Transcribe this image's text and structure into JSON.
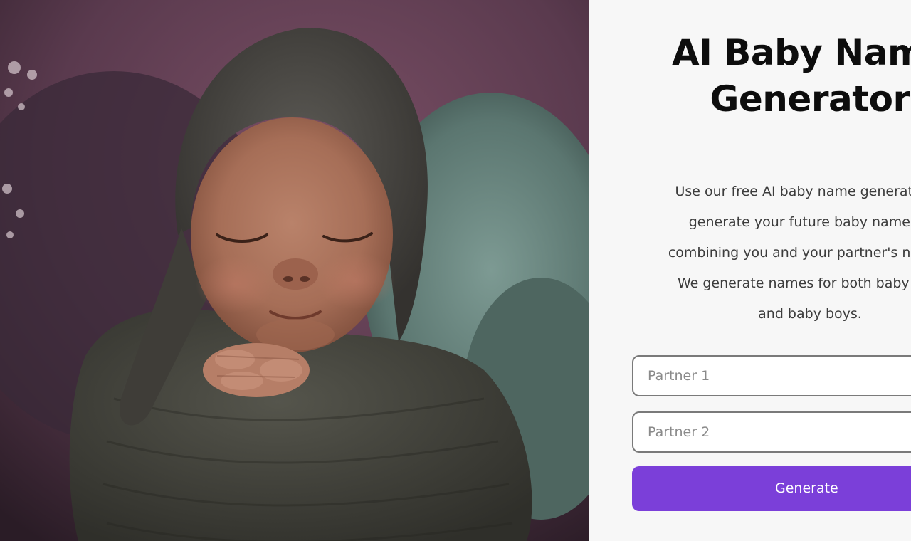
{
  "hero": {
    "image_alt": "Sleeping newborn baby wrapped in knitted grey bonnet and blanket"
  },
  "form": {
    "title_line1": "AI Baby Name",
    "title_line2": "Generator",
    "description_lines": [
      "Use our free AI baby name generator to",
      "generate your future baby name by",
      "combining you and your partner's names.",
      "We generate names for both baby girls",
      "and baby boys."
    ],
    "partner1_placeholder": "Partner 1",
    "partner1_value": "",
    "partner2_placeholder": "Partner 2",
    "partner2_value": "",
    "generate_label": "Generate"
  },
  "colors": {
    "accent": "#7b3fd9",
    "panel_background": "#f7f7f7",
    "title_text": "#0d0d0d"
  }
}
